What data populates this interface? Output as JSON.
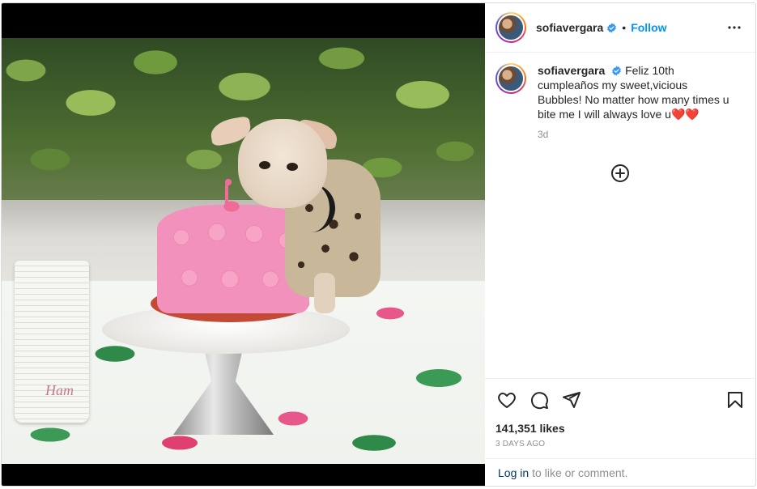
{
  "post": {
    "username": "sofiavergara",
    "follow_label": "Follow",
    "separator": "•",
    "caption": "Feliz 10th cumpleaños my sweet,vicious Bubbles! No matter how many times u bite me I will always love u❤️❤️",
    "time_ago": "3d",
    "likes": "141,351 likes",
    "date": "3 DAYS AGO",
    "cup_text": "Ham"
  },
  "footer": {
    "login_link": "Log in",
    "login_text": "to like or comment."
  },
  "icons": {
    "like": "heart-icon",
    "comment": "comment-icon",
    "share": "paper-plane-icon",
    "save": "bookmark-icon",
    "more": "more-horizontal-icon",
    "load_more": "plus-circle-icon",
    "verified": "verified-badge-icon"
  },
  "colors": {
    "follow": "#0095f6",
    "verified": "#3897f0",
    "login_link": "#00376b",
    "muted": "#8e8e8e"
  }
}
